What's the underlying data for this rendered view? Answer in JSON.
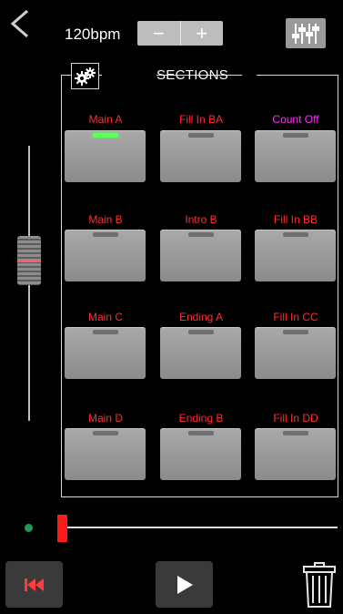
{
  "header": {
    "tempo": "120bpm",
    "decrement_symbol": "−",
    "increment_symbol": "+"
  },
  "sections": {
    "title": "SECTIONS",
    "pads": [
      {
        "label": "Main A",
        "active": true,
        "label_color": "#ff2d2d"
      },
      {
        "label": "Fill In BA",
        "active": false,
        "label_color": "#ff2d2d"
      },
      {
        "label": "Count Off",
        "active": false,
        "label_color": "#ff2dff"
      },
      {
        "label": "Main B",
        "active": false,
        "label_color": "#ff2d2d"
      },
      {
        "label": "Intro B",
        "active": false,
        "label_color": "#ff2d2d"
      },
      {
        "label": "Fill In BB",
        "active": false,
        "label_color": "#ff2d2d"
      },
      {
        "label": "Main C",
        "active": false,
        "label_color": "#ff2d2d"
      },
      {
        "label": "Ending A",
        "active": false,
        "label_color": "#ff2d2d"
      },
      {
        "label": "Fill In CC",
        "active": false,
        "label_color": "#ff2d2d"
      },
      {
        "label": "Main D",
        "active": false,
        "label_color": "#ff2d2d"
      },
      {
        "label": "Ending B",
        "active": false,
        "label_color": "#ff2d2d"
      },
      {
        "label": "Fill In DD",
        "active": false,
        "label_color": "#ff2d2d"
      }
    ]
  },
  "volume": {
    "level": 0.6
  },
  "playback": {
    "progress": 0.0
  },
  "icons": {
    "back": "back-arrow-icon",
    "mixer": "mixer-icon",
    "settings": "gears-icon",
    "rewind": "skip-to-start-icon",
    "play": "play-icon",
    "delete": "trash-icon"
  },
  "colors": {
    "accent_red": "#ff2d2d",
    "accent_magenta": "#ff2dff",
    "active_led": "#5dff5d",
    "playhead": "#ff1a1a",
    "status_dot": "#1b9c5c"
  }
}
